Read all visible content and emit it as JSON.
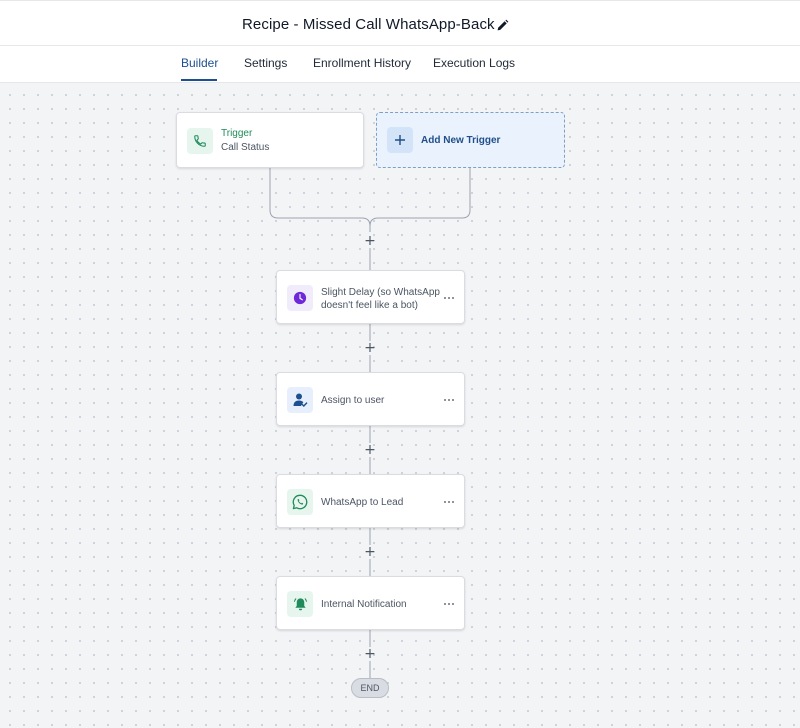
{
  "header": {
    "title": "Recipe - Missed Call WhatsApp-Back",
    "edit_icon": "pencil-icon"
  },
  "tabs": [
    {
      "label": "Builder",
      "active": true
    },
    {
      "label": "Settings",
      "active": false
    },
    {
      "label": "Enrollment History",
      "active": false
    },
    {
      "label": "Execution Logs",
      "active": false
    }
  ],
  "trigger": {
    "title": "Trigger",
    "subtitle": "Call Status",
    "icon": "phone-icon"
  },
  "add_trigger": {
    "label": "Add New Trigger",
    "icon": "plus-icon"
  },
  "steps": [
    {
      "label_line1": "Slight Delay (so WhatsApp",
      "label_line2": "doesn't feel like a bot)",
      "icon": "clock-icon"
    },
    {
      "label": "Assign to user",
      "icon": "user-assign-icon"
    },
    {
      "label": "WhatsApp to Lead",
      "icon": "whatsapp-icon"
    },
    {
      "label": "Internal Notification",
      "icon": "bell-icon"
    }
  ],
  "add_step_symbol": "+",
  "end_label": "END",
  "colors": {
    "accent": "#1d4f91",
    "trigger_green": "#1f8a5a",
    "delay_purple": "#6d28d9",
    "add_trigger_bg": "#eaf2fd"
  }
}
